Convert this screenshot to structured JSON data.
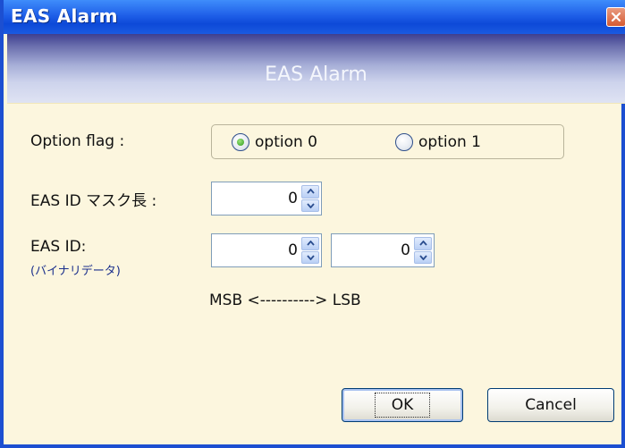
{
  "window": {
    "title": "EAS Alarm",
    "header_title": "EAS Alarm"
  },
  "form": {
    "option_flag_label": "Option flag :",
    "options": [
      {
        "label": "option 0",
        "checked": true
      },
      {
        "label": "option 1",
        "checked": false
      }
    ],
    "mask_length_label": "EAS ID マスク長 :",
    "mask_length_value": "0",
    "eas_id_label": "EAS ID:",
    "eas_id_sublabel": "(バイナリデータ)",
    "eas_id_values": [
      "0",
      "0"
    ],
    "bit_order_text": "MSB <----------> LSB"
  },
  "buttons": {
    "ok_label": "OK",
    "cancel_label": "Cancel"
  },
  "icons": {
    "close": "close-icon",
    "spin_up": "chevron-up-icon",
    "spin_down": "chevron-down-icon",
    "radio": "radio-icon"
  },
  "colors": {
    "titlebar": "#1f5fe8",
    "dialog_background": "#fcf6de",
    "sublabel": "#1b2f8c",
    "radio_checked": "#2f9a1e"
  }
}
